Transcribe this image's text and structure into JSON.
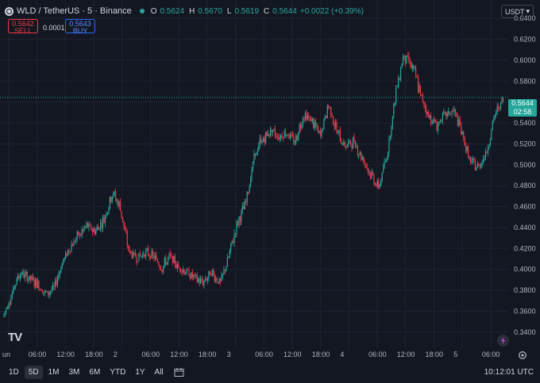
{
  "header": {
    "symbol": "WLD / TetherUS · 5 · Binance",
    "open_k": "O",
    "open_v": "0.5624",
    "high_k": "H",
    "high_v": "0.5670",
    "low_k": "L",
    "low_v": "0.5619",
    "close_k": "C",
    "close_v": "0.5644",
    "change": "+0.0022 (+0.39%)"
  },
  "trade": {
    "sell_price": "0.5642",
    "sell_label": "SELL",
    "spread": "0.0001",
    "buy_price": "0.5643",
    "buy_label": "BUY"
  },
  "currency": "USDT",
  "price_tag": {
    "price": "0.5644",
    "countdown": "02:58"
  },
  "axis": {
    "y_labels": [
      "0.6400",
      "0.6200",
      "0.6000",
      "0.5800",
      "0.5600",
      "0.5400",
      "0.5200",
      "0.5000",
      "0.4800",
      "0.4600",
      "0.4400",
      "0.4200",
      "0.4000",
      "0.3800",
      "0.3600",
      "0.3400"
    ],
    "x_labels": [
      "un",
      "06:00",
      "12:00",
      "18:00",
      "2",
      "06:00",
      "12:00",
      "18:00",
      "3",
      "06:00",
      "12:00",
      "18:00",
      "4",
      "06:00",
      "12:00",
      "18:00",
      "5",
      "06:00"
    ]
  },
  "timeframes": [
    "1D",
    "5D",
    "1M",
    "3M",
    "6M",
    "YTD",
    "1Y",
    "All"
  ],
  "active_timeframe": "5D",
  "clock": "10:12:01 UTC",
  "logo": "TV",
  "chart_data": {
    "type": "candlestick",
    "ylim": [
      0.33,
      0.65
    ],
    "y_ticks": [
      0.64,
      0.62,
      0.6,
      0.58,
      0.56,
      0.54,
      0.52,
      0.5,
      0.48,
      0.46,
      0.44,
      0.42,
      0.4,
      0.38,
      0.36,
      0.34
    ],
    "last_price": 0.5644,
    "colors": {
      "up": "#26a69a",
      "down": "#f23645"
    },
    "trend": [
      [
        0.355,
        0.36
      ],
      [
        0.375,
        0.385
      ],
      [
        0.395,
        0.398
      ],
      [
        0.39,
        0.393
      ],
      [
        0.385,
        0.388
      ],
      [
        0.375,
        0.378
      ],
      [
        0.38,
        0.383
      ],
      [
        0.405,
        0.408
      ],
      [
        0.42,
        0.425
      ],
      [
        0.43,
        0.434
      ],
      [
        0.44,
        0.442
      ],
      [
        0.435,
        0.44
      ],
      [
        0.445,
        0.45
      ],
      [
        0.47,
        0.478
      ],
      [
        0.455,
        0.46
      ],
      [
        0.415,
        0.418
      ],
      [
        0.41,
        0.412
      ],
      [
        0.415,
        0.418
      ],
      [
        0.41,
        0.414
      ],
      [
        0.4,
        0.405
      ],
      [
        0.41,
        0.413
      ],
      [
        0.4,
        0.405
      ],
      [
        0.395,
        0.398
      ],
      [
        0.39,
        0.393
      ],
      [
        0.385,
        0.39
      ],
      [
        0.395,
        0.398
      ],
      [
        0.385,
        0.388
      ],
      [
        0.41,
        0.415
      ],
      [
        0.44,
        0.445
      ],
      [
        0.46,
        0.465
      ],
      [
        0.5,
        0.51
      ],
      [
        0.52,
        0.525
      ],
      [
        0.53,
        0.535
      ],
      [
        0.525,
        0.528
      ],
      [
        0.53,
        0.532
      ],
      [
        0.52,
        0.525
      ],
      [
        0.545,
        0.55
      ],
      [
        0.54,
        0.545
      ],
      [
        0.525,
        0.53
      ],
      [
        0.555,
        0.56
      ],
      [
        0.53,
        0.535
      ],
      [
        0.515,
        0.52
      ],
      [
        0.52,
        0.525
      ],
      [
        0.505,
        0.51
      ],
      [
        0.49,
        0.495
      ],
      [
        0.475,
        0.48
      ],
      [
        0.505,
        0.51
      ],
      [
        0.56,
        0.57
      ],
      [
        0.6,
        0.61
      ],
      [
        0.59,
        0.6
      ],
      [
        0.565,
        0.57
      ],
      [
        0.545,
        0.55
      ],
      [
        0.535,
        0.54
      ],
      [
        0.545,
        0.548
      ],
      [
        0.55,
        0.555
      ],
      [
        0.53,
        0.535
      ],
      [
        0.5,
        0.505
      ],
      [
        0.495,
        0.5
      ],
      [
        0.51,
        0.515
      ],
      [
        0.545,
        0.55
      ],
      [
        0.56,
        0.5644
      ]
    ]
  }
}
